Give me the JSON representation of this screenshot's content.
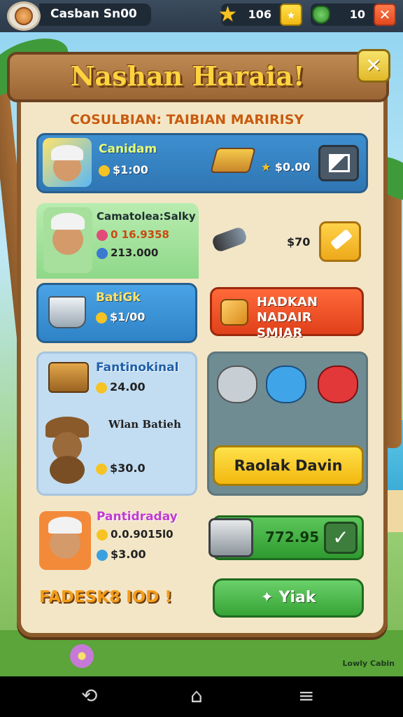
{
  "topbar": {
    "player_name": "Casban Sn00",
    "stars_value": "106",
    "gems_value": "10",
    "close_label": "✕"
  },
  "banner": {
    "title": "Nashan Haraia!",
    "close_label": "✕"
  },
  "subtitle": "COSULBIAN: TAIBIAN MARIRISY",
  "rows": {
    "r1": {
      "name": "Canidam",
      "price": "$1:00",
      "reward": "$0.00"
    },
    "r2": {
      "name": "Camatolea:Salky",
      "stat1": "0 16.9358",
      "stat2": "213.000",
      "reward": "$70"
    },
    "r3": {
      "name": "BatiGk",
      "price": "$1/00"
    },
    "r3_action": {
      "line1": "HADKAN",
      "line2": "NADAIR SMIAR"
    },
    "r4": {
      "name": "Fantinokinal",
      "stat1": "24.00",
      "stat2": "Wlan Batieh",
      "price": "$30.0"
    },
    "r4_action": "Raolak Davin",
    "r5": {
      "name": "Pantidraday",
      "stat1": "0.0.9015l0",
      "price": "$3.00",
      "bar_value": "772.95"
    },
    "yiak_label": "Yiak",
    "footer_text": "FADESK8 IOD !"
  },
  "watermark": "Lowly Cabin",
  "colors": {
    "accent": "#ffd23f",
    "wood": "#8b5a2b",
    "green": "#36a436",
    "red": "#e0401a"
  },
  "nav": {
    "back": "⟲",
    "home": "⌂",
    "recent": "≡"
  }
}
